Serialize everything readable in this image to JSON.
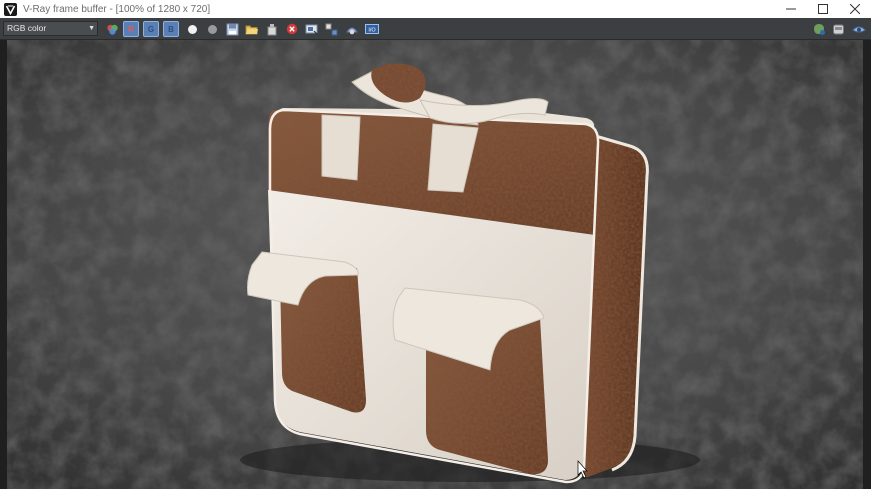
{
  "window": {
    "title": "V-Ray frame buffer - [100% of 1280 x 720]",
    "controls": [
      "minimize-icon",
      "maximize-icon",
      "close-icon"
    ]
  },
  "toolbar": {
    "channel_select": "RGB color",
    "channel_buttons": [
      {
        "name": "red-channel-button",
        "label": "R",
        "color": "#c0504d"
      },
      {
        "name": "green-channel-button",
        "label": "G",
        "color": "#4f81bd"
      },
      {
        "name": "blue-channel-button",
        "label": "B",
        "color": "#4f81bd"
      }
    ],
    "icons": [
      "color-channels-icon",
      "white-circle-icon",
      "gray-circle-icon",
      "save-image-icon",
      "open-image-icon",
      "clear-image-icon",
      "stop-render-icon",
      "region-render-icon",
      "track-mouse-icon",
      "render-last-icon",
      "vfb-history-icon",
      "lens-effects-icon",
      "teapot-render-icon",
      "settings-icon",
      "render-icon"
    ]
  },
  "render": {
    "subject": "leather-briefcase-render",
    "colors": {
      "leather": "#7a4a32",
      "canvas": "#ece6de",
      "background": "#505050"
    }
  }
}
